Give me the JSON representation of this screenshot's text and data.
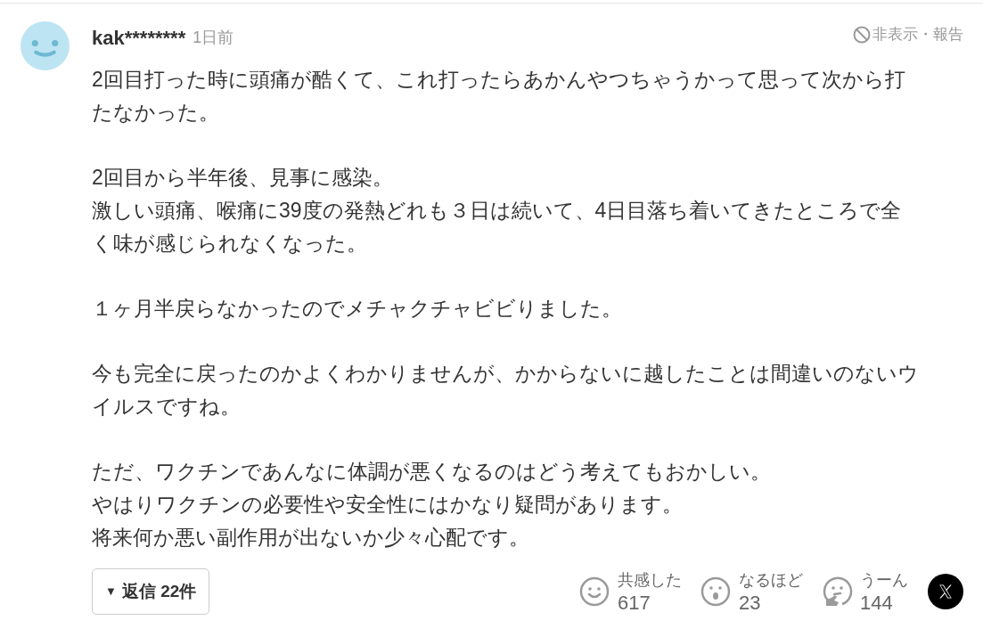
{
  "comment": {
    "user": "kak********",
    "time": "1日前",
    "hide_report": "非表示・報告"
  },
  "paragraphs": [
    {
      "lines": [
        "2回目打った時に頭痛が酷くて、これ打ったらあかんやつちゃうかって思って次から打",
        "たなかった。"
      ]
    },
    {
      "lines": [
        "2回目から半年後、見事に感染。",
        "激しい頭痛、喉痛に39度の発熱どれも３日は続いて、4日目落ち着いてきたところで全",
        "く味が感じられなくなった。"
      ]
    },
    {
      "lines": [
        "１ヶ月半戻らなかったのでメチャクチャビビりました。"
      ]
    },
    {
      "lines": [
        "今も完全に戻ったのかよくわかりませんが、かからないに越したことは間違いのないウ",
        "イルスですね。"
      ]
    },
    {
      "lines": [
        "ただ、ワクチンであんなに体調が悪くなるのはどう考えてもおかしい。",
        "やはりワクチンの必要性や安全性にはかなり疑問があります。",
        "将来何か悪い副作用が出ないか少々心配です。"
      ]
    }
  ],
  "replies_button": {
    "arrow": "▼",
    "label": "返信 22件"
  },
  "reactions": [
    {
      "kind": "smile",
      "label": "共感した",
      "count": "617"
    },
    {
      "kind": "surprised",
      "label": "なるほど",
      "count": "23"
    },
    {
      "kind": "thinking",
      "label": "うーん",
      "count": "144"
    }
  ]
}
